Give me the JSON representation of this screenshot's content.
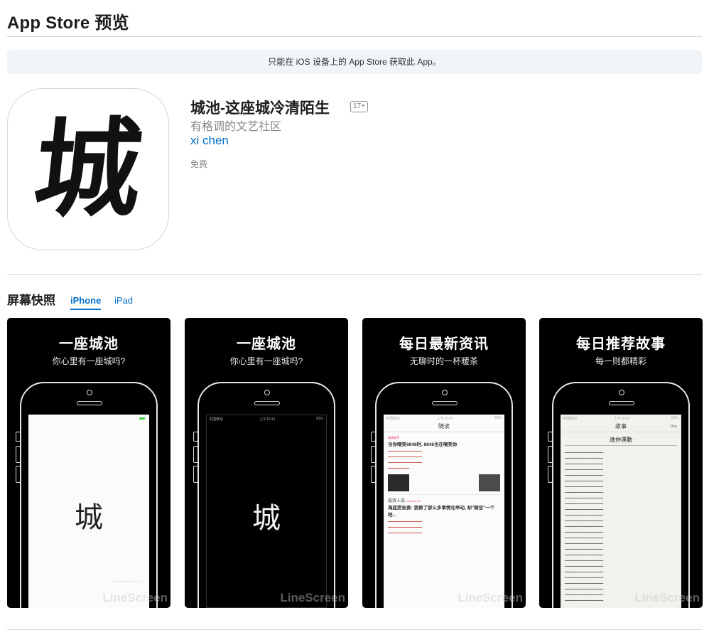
{
  "header": {
    "title": "App Store 预览"
  },
  "banner": {
    "text": "只能在 iOS 设备上的 App Store 获取此 App。"
  },
  "app": {
    "icon_char": "城",
    "name": "城池-这座城冷清陌生",
    "age_rating": "17+",
    "subtitle": "有格调的文艺社区",
    "developer": "xi chen",
    "price": "免费"
  },
  "screenshots_section": {
    "title": "屏幕快照",
    "tabs": [
      {
        "label": "iPhone",
        "selected": true
      },
      {
        "label": "iPad",
        "selected": false
      }
    ],
    "shots": [
      {
        "headline": "一座城池",
        "tagline": "你心里有一座城吗?",
        "screen_char": "城",
        "status_time": "",
        "watermark": "LineScreen",
        "theme": "light"
      },
      {
        "headline": "一座城池",
        "tagline": "你心里有一座城吗?",
        "screen_char": "城",
        "status_time": "上午10:41",
        "status_carrier": "中国移动",
        "status_battery": "83%",
        "watermark": "LineScreen",
        "theme": "dark"
      },
      {
        "headline": "每日最新资讯",
        "tagline": "无聊时的一杯暖茶",
        "nav_title": "随读",
        "status_time": "上午10:41",
        "status_carrier": "中国移动",
        "status_battery": "83%",
        "feed_title_1": "当你嘲笑8848时, 8848也在嘲笑你",
        "feed_title_2": "海底捞张勇: 我做了那么多事情化举动, 却\"微信\"一个吧...",
        "feed_author": "投资人说",
        "feed_tag": "编辑推荐",
        "feed_date": "2018-03-11",
        "watermark": "LineScreen"
      },
      {
        "headline": "每日推荐故事",
        "tagline": "每一则都精彩",
        "nav_title": "故事",
        "nav_option": "One",
        "status_time": "上午10:41",
        "status_carrier": "中国移动",
        "status_battery": "83%",
        "story_title": "逸仲運動",
        "watermark": "LineScreen"
      }
    ]
  },
  "colors": {
    "link": "#0070c9",
    "banner_bg": "#f2f5f8",
    "shot_bg": "#000000"
  }
}
